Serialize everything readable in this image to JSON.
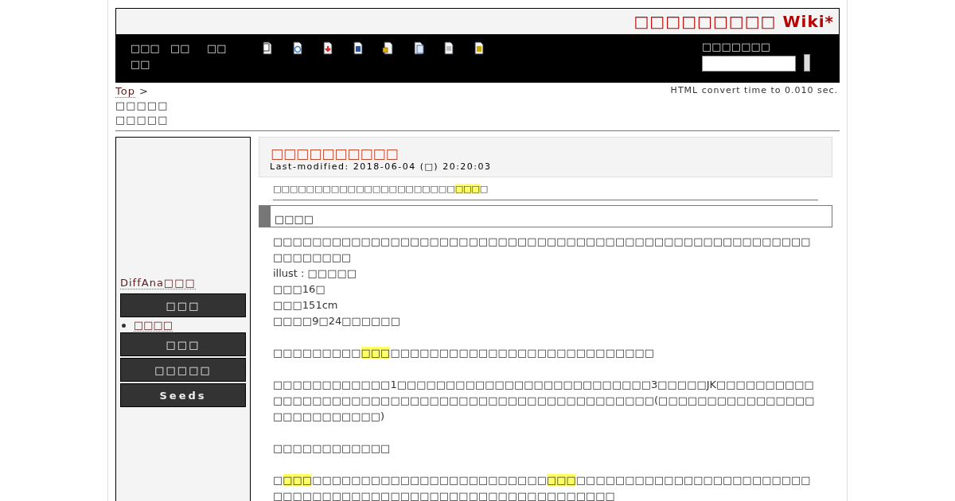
{
  "header": {
    "title": "□□□□□□□□□ Wiki*"
  },
  "nav": {
    "links": [
      "□□□□□",
      "□□",
      "□□"
    ],
    "icons": [
      {
        "kind": "copy"
      },
      {
        "kind": "history"
      },
      {
        "kind": "diff"
      },
      {
        "kind": "save"
      },
      {
        "kind": "lock"
      },
      {
        "kind": "list"
      },
      {
        "kind": "new"
      },
      {
        "kind": "help"
      }
    ],
    "search_label": "□□□□□□□"
  },
  "breadcrumb": {
    "top": "Top",
    "separator": ">",
    "items": [
      "□□□□□",
      "□□□□□"
    ]
  },
  "convert_time": "HTML convert time to 0.010 sec.",
  "sidebar": {
    "items": [
      {
        "kind": "link",
        "text": "DiffAna□□□"
      },
      {
        "kind": "button",
        "text": "□□□"
      },
      {
        "kind": "bullet",
        "text": "□□□□"
      },
      {
        "kind": "button",
        "text": "□□□"
      },
      {
        "kind": "button",
        "text": "□□□□□"
      },
      {
        "kind": "button",
        "text": "Seeds"
      }
    ]
  },
  "page": {
    "title": "□□□□□□□□□□",
    "last_modified": "Last-modified: 2018-06-04 (□) 20:20:03",
    "summary": [
      {
        "text": "□□□□□□□□□□□□□□□□□□□□□□",
        "highlighted": false
      },
      {
        "text": "□□□",
        "highlighted": true
      },
      {
        "text": "□",
        "highlighted": false
      }
    ],
    "heading": "□□□□",
    "paragraphs": [
      [
        {
          "text": "□□□□□□□□□□□□□□□□□□□□□□□□□□□□□□□□□□□□□□□□□□□□□□□□□□□□□□□□□□□□□□□",
          "highlighted": false
        }
      ],
      [
        {
          "text": "illust : □□□□□",
          "highlighted": false
        }
      ],
      [
        {
          "text": "□□□16□",
          "highlighted": false
        }
      ],
      [
        {
          "text": "□□□151cm",
          "highlighted": false
        }
      ],
      [
        {
          "text": "□□□□9□24□□□□□□",
          "highlighted": false
        }
      ],
      [
        {
          "text": "□□□□□□□□□",
          "highlighted": false
        },
        {
          "text": "□□□",
          "highlighted": true
        },
        {
          "text": "□□□□□□□□□□□□□□□□□□□□□□□□□□□",
          "highlighted": false
        }
      ],
      [
        {
          "text": "□□□□□□□□□□□□1□□□□□□□□□□□□□□□□□□□□□□□□□□3□□□□□JK□□□□□□□□□□□□□□□□□□□□□□□□□□□□□□□□□□□□□□□□□□□□□□□□□(□□□□□□□□□□□□□□□□□□□□□□□□□□□)",
          "highlighted": false
        }
      ],
      [
        {
          "text": "□□□□□□□□□□□□",
          "highlighted": false
        }
      ],
      [
        {
          "text": "□",
          "highlighted": false
        },
        {
          "text": "□□□",
          "highlighted": true
        },
        {
          "text": "□□□□□□□□□□□□□□□□□□□□□□□□",
          "highlighted": false
        },
        {
          "text": "□□□",
          "highlighted": true
        },
        {
          "text": "□□□□□□□□□□□□□□□□□□□□□□□□□□□□□□□□□□□□□□□□□□□□□□□□□□□□□□□□□□□",
          "highlighted": false
        }
      ]
    ]
  }
}
